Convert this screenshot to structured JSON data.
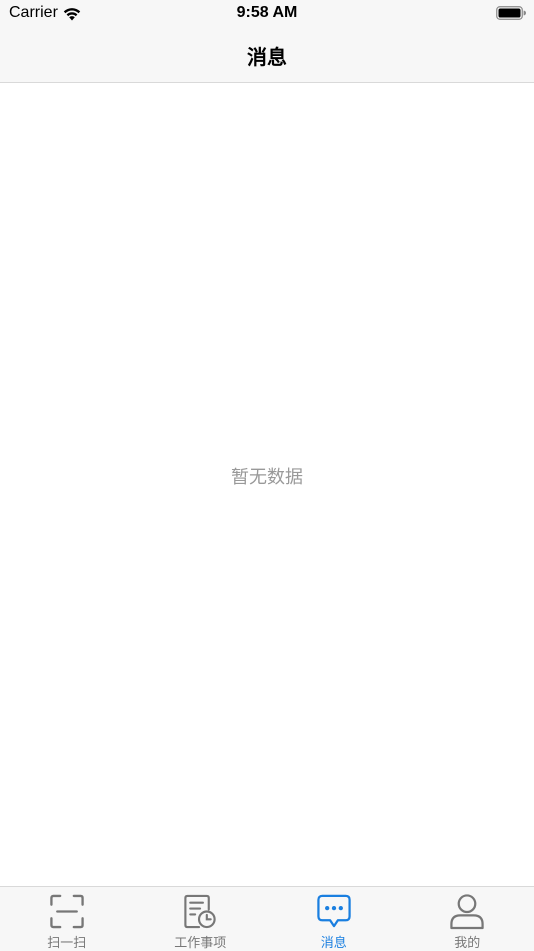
{
  "status_bar": {
    "carrier": "Carrier",
    "time": "9:58 AM"
  },
  "nav": {
    "title": "消息"
  },
  "content": {
    "empty_text": "暂无数据"
  },
  "tabs": [
    {
      "label": "扫一扫",
      "icon": "scan-icon",
      "active": false
    },
    {
      "label": "工作事项",
      "icon": "work-items-icon",
      "active": false
    },
    {
      "label": "消息",
      "icon": "message-icon",
      "active": true
    },
    {
      "label": "我的",
      "icon": "profile-icon",
      "active": false
    }
  ],
  "colors": {
    "accent": "#1a7fe0",
    "inactive": "#777777",
    "empty_text": "#999999",
    "bar_background": "#f7f7f7"
  }
}
